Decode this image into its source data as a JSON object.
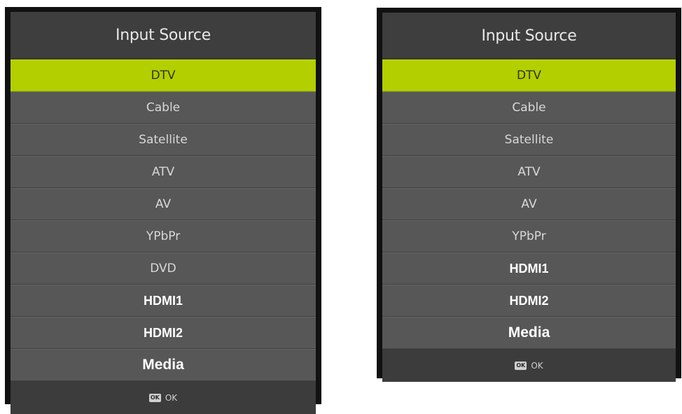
{
  "menus": [
    {
      "title": "Input Source",
      "items": [
        {
          "label": "DTV",
          "selected": true
        },
        {
          "label": "Cable"
        },
        {
          "label": "Satellite"
        },
        {
          "label": "ATV"
        },
        {
          "label": "AV"
        },
        {
          "label": "YPbPr"
        },
        {
          "label": "DVD"
        },
        {
          "label": "HDMI1"
        },
        {
          "label": "HDMI2"
        },
        {
          "label": "Media"
        }
      ],
      "footer": {
        "key_icon": "ok-key-icon",
        "key_text": "OK",
        "label": "OK"
      }
    },
    {
      "title": "Input Source",
      "items": [
        {
          "label": "DTV",
          "selected": true
        },
        {
          "label": "Cable"
        },
        {
          "label": "Satellite"
        },
        {
          "label": "ATV"
        },
        {
          "label": "AV"
        },
        {
          "label": "YPbPr"
        },
        {
          "label": "HDMI1"
        },
        {
          "label": "HDMI2"
        },
        {
          "label": "Media"
        }
      ],
      "footer": {
        "key_icon": "ok-key-icon",
        "key_text": "OK",
        "label": "OK"
      }
    }
  ],
  "colors": {
    "highlight": "#b3cf00",
    "item_background": "#575757",
    "title_background": "#3e3e3e",
    "frame": "#111111"
  }
}
